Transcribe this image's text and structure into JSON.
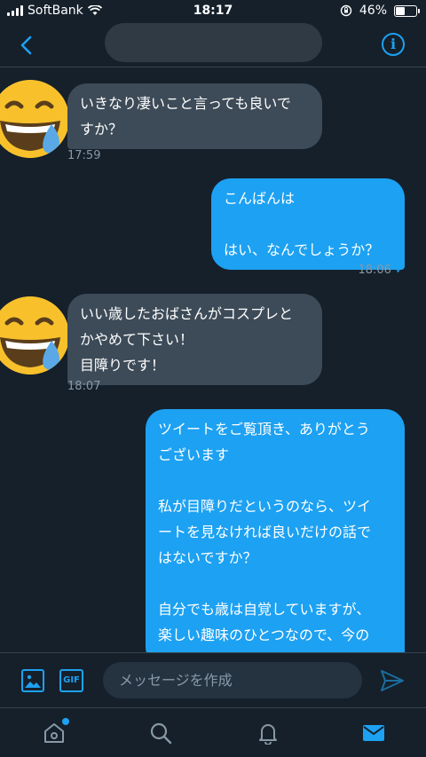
{
  "status_bar": {
    "carrier": "SoftBank",
    "time": "18:17",
    "battery": "46%",
    "battery_level": 0.46
  },
  "header": {
    "title": ""
  },
  "messages": [
    {
      "direction": "in",
      "text": "いきなり凄いこと言っても良いで\nすか？",
      "time": "17:59"
    },
    {
      "direction": "out",
      "text": "こんばんは\n\nはい、なんでしょうか？",
      "time": "18:06",
      "read": "✓"
    },
    {
      "direction": "in",
      "text": "いい歳したおばさんがコスプレと\nかやめて下さい！\n目障りです！",
      "time": "18:07"
    },
    {
      "direction": "out",
      "text": "ツイートをご覧頂き、ありがとう\nございます\n\n私が目障りだというのなら、ツイ\nートを見なければ良いだけの話で\nはないですか？\n\n自分でも歳は自覚していますが、\n楽しい趣味のひとつなので、今の\nところ止めるつもりはありません"
    }
  ],
  "composer": {
    "placeholder": "メッセージを作成",
    "gif_label": "GIF"
  },
  "colors": {
    "accent": "#1da1f2",
    "background": "#15202b",
    "incoming_bubble": "#3d4b58"
  },
  "nav": {
    "items": [
      "home-icon",
      "search-icon",
      "bell-icon",
      "mail-icon"
    ],
    "active": "mail-icon"
  }
}
